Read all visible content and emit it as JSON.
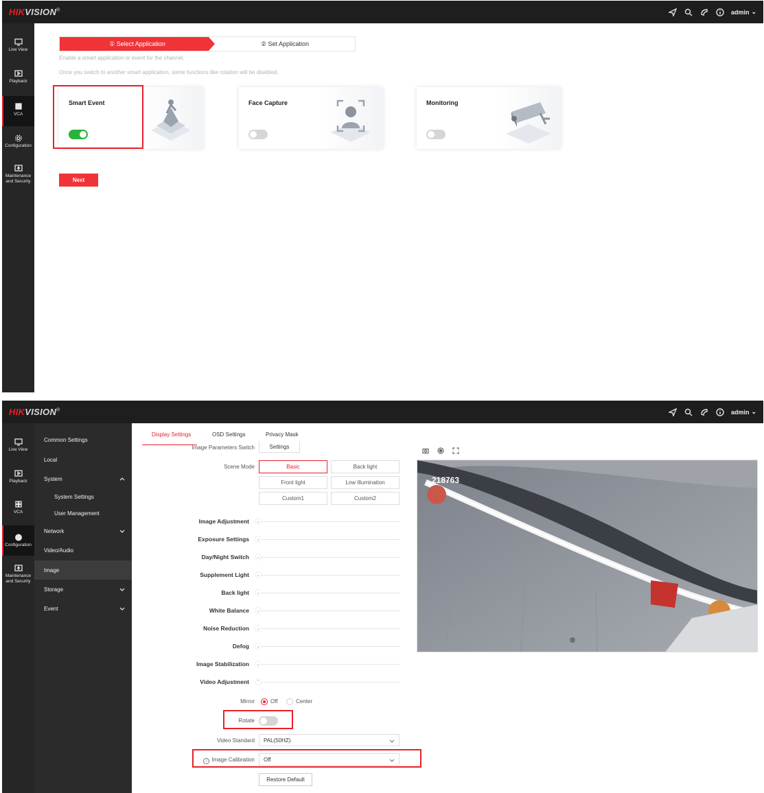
{
  "brand": {
    "hik": "HIK",
    "vision": "VISION",
    "reg": "®"
  },
  "topbar": {
    "user": "admin",
    "icons": [
      "send-icon",
      "search-icon",
      "help-icon",
      "info-icon"
    ]
  },
  "leftnav": {
    "items": [
      {
        "label": "Live View",
        "icon": "monitor-icon"
      },
      {
        "label": "Playback",
        "icon": "playback-icon"
      },
      {
        "label": "VCA",
        "icon": "vca-icon"
      },
      {
        "label": "Configuration",
        "icon": "gear-icon"
      },
      {
        "label": "Maintenance and Security",
        "label_lines": [
          "Maintenance",
          "and Security"
        ],
        "icon": "maintenance-icon"
      }
    ]
  },
  "panel1": {
    "steps": {
      "step1": "① Select Application",
      "step2": "② Set Application"
    },
    "hint1": "Enable a smart application or event for the channel.",
    "hint2": "Once you switch to another smart application, some functions like rotation will be disabled.",
    "cards": [
      {
        "title": "Smart Event",
        "enabled": true,
        "icon": "smart-event-icon"
      },
      {
        "title": "Face Capture",
        "enabled": false,
        "icon": "face-capture-icon"
      },
      {
        "title": "Monitoring",
        "enabled": false,
        "icon": "camera-icon"
      }
    ],
    "next_label": "Next",
    "accent_color": "#f03337",
    "toggle_on_color": "#29b33a"
  },
  "panel2": {
    "subnav": {
      "items": [
        {
          "label": "Common Settings"
        },
        {
          "label": "Local"
        },
        {
          "label": "System",
          "expanded": true
        },
        {
          "label": "System Settings",
          "child": true
        },
        {
          "label": "User Management",
          "child": true
        },
        {
          "label": "Network",
          "expanded": false
        },
        {
          "label": "Video/Audio"
        },
        {
          "label": "Image",
          "active": true
        },
        {
          "label": "Storage",
          "expanded": false
        },
        {
          "label": "Event",
          "expanded": false
        }
      ]
    },
    "tabs": [
      "Display Settings",
      "OSD Settings",
      "Privacy Mask"
    ],
    "image_params": {
      "label": "Image Parameters Switch",
      "button": "Settings"
    },
    "scene_mode": {
      "label": "Scene Mode",
      "options": [
        "Basic",
        "Back light",
        "Front light",
        "Low Illumination",
        "Custom1",
        "Custom2"
      ],
      "selected": "Basic"
    },
    "sections": [
      "Image Adjustment",
      "Exposure Settings",
      "Day/Night Switch",
      "Supplement Light",
      "Back light",
      "White Balance",
      "Noise Reduction",
      "Defog",
      "Image Stabilization",
      "Video Adjustment"
    ],
    "mirror": {
      "label": "Mirror",
      "options": [
        "Off",
        "Center"
      ],
      "selected": "Off"
    },
    "rotate": {
      "label": "Rotate",
      "enabled": false
    },
    "video_standard": {
      "label": "Video Standard",
      "value": "PAL(50HZ)"
    },
    "image_calibration": {
      "label": "Image Calibration",
      "value": "Off"
    },
    "restore_label": "Restore Default",
    "video_osd": "218763",
    "video_tools": [
      "snapshot-icon",
      "record-icon",
      "fullscreen-icon"
    ]
  }
}
